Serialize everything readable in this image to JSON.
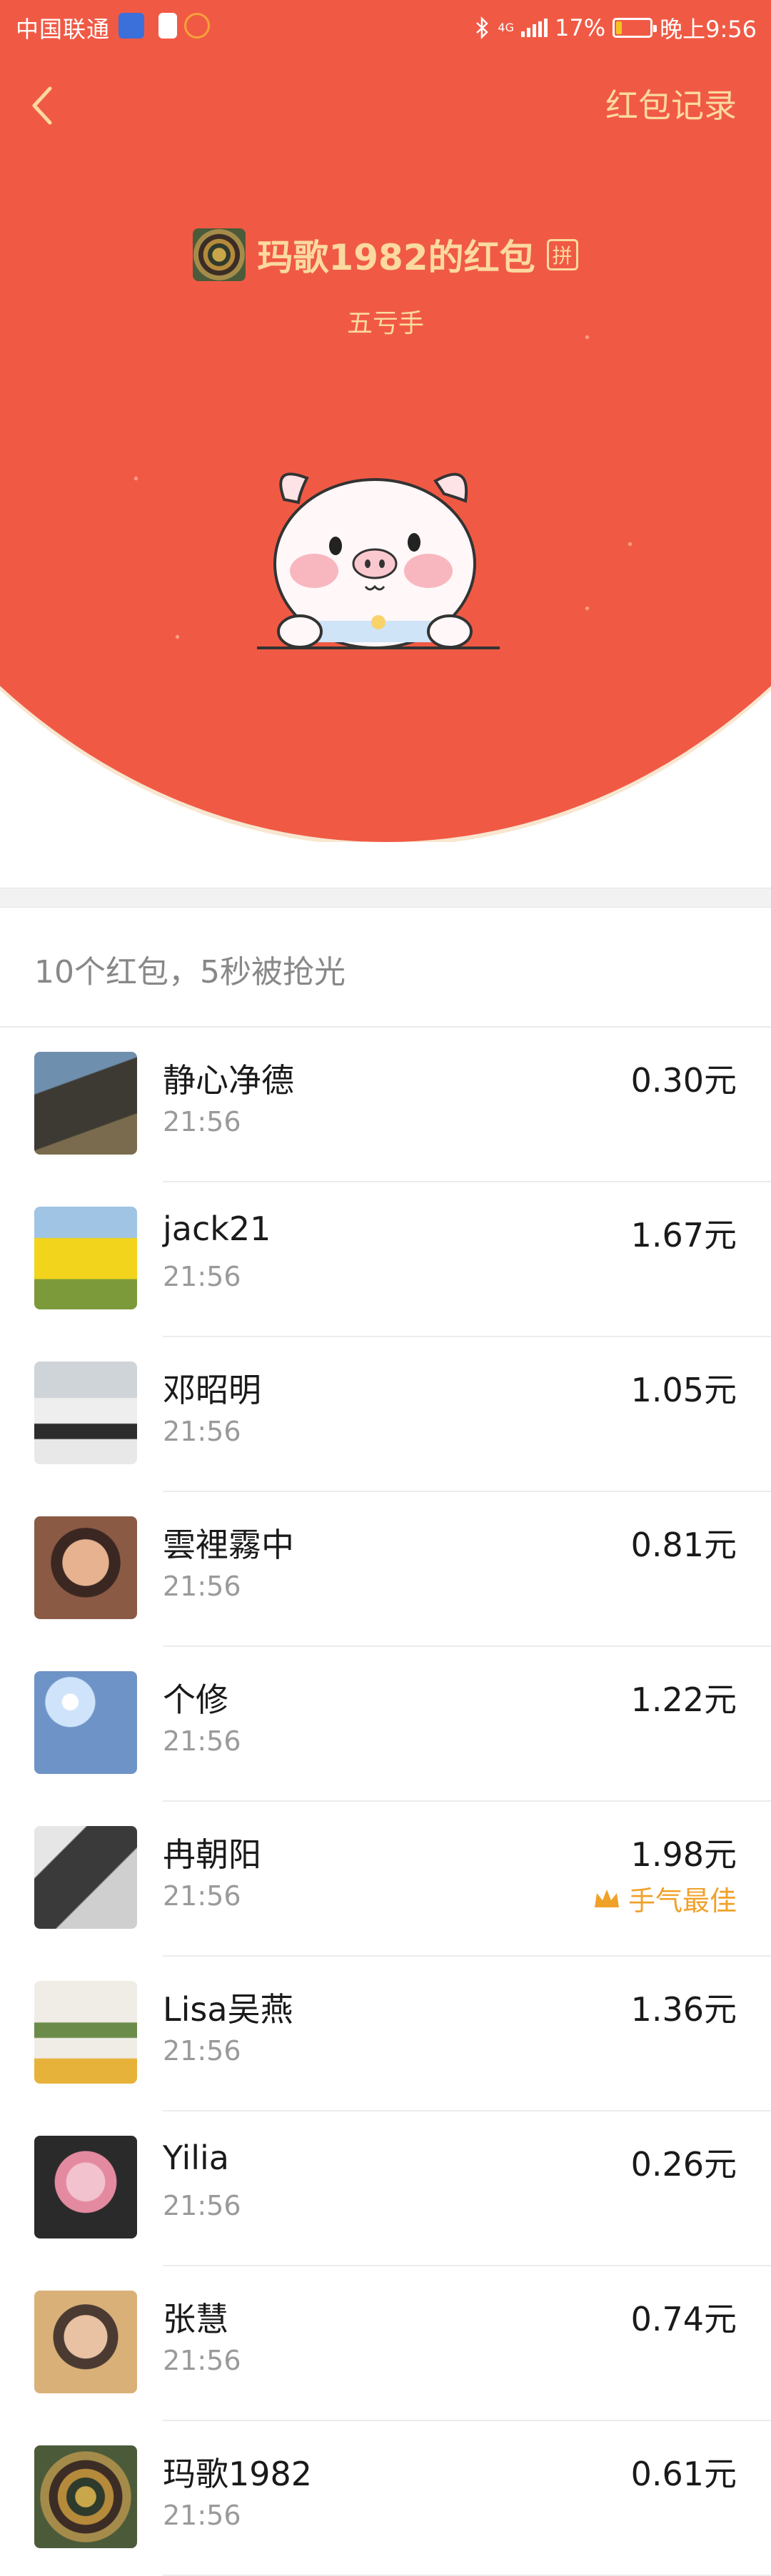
{
  "status_bar": {
    "carrier": "中国联通",
    "network": "4G",
    "battery": "17%",
    "battery_level": 0.17,
    "time": "晚上9:56"
  },
  "nav": {
    "records_label": "红包记录"
  },
  "envelope": {
    "sender_name": "玛歌1982的红包",
    "pin_badge": "拼",
    "blessing": "五亏手"
  },
  "summary": "10个红包，5秒被抢光",
  "receivers": [
    {
      "name": "静心净德",
      "time": "21:56",
      "amount": "0.30元",
      "best": ""
    },
    {
      "name": "jack21",
      "time": "21:56",
      "amount": "1.67元",
      "best": ""
    },
    {
      "name": "邓昭明",
      "time": "21:56",
      "amount": "1.05元",
      "best": ""
    },
    {
      "name": "雲裡霧中",
      "time": "21:56",
      "amount": "0.81元",
      "best": ""
    },
    {
      "name": "个修",
      "time": "21:56",
      "amount": "1.22元",
      "best": ""
    },
    {
      "name": "冉朝阳",
      "time": "21:56",
      "amount": "1.98元",
      "best": "手气最佳"
    },
    {
      "name": "Lisa吴燕",
      "time": "21:56",
      "amount": "1.36元",
      "best": ""
    },
    {
      "name": "Yilia",
      "time": "21:56",
      "amount": "0.26元",
      "best": ""
    },
    {
      "name": "张慧",
      "time": "21:56",
      "amount": "0.74元",
      "best": ""
    },
    {
      "name": "玛歌1982",
      "time": "21:56",
      "amount": "0.61元",
      "best": ""
    }
  ],
  "colors": {
    "envelope_red": "#f05a45",
    "gold_text": "#fbd9a0",
    "best_luck": "#f0a12a"
  }
}
